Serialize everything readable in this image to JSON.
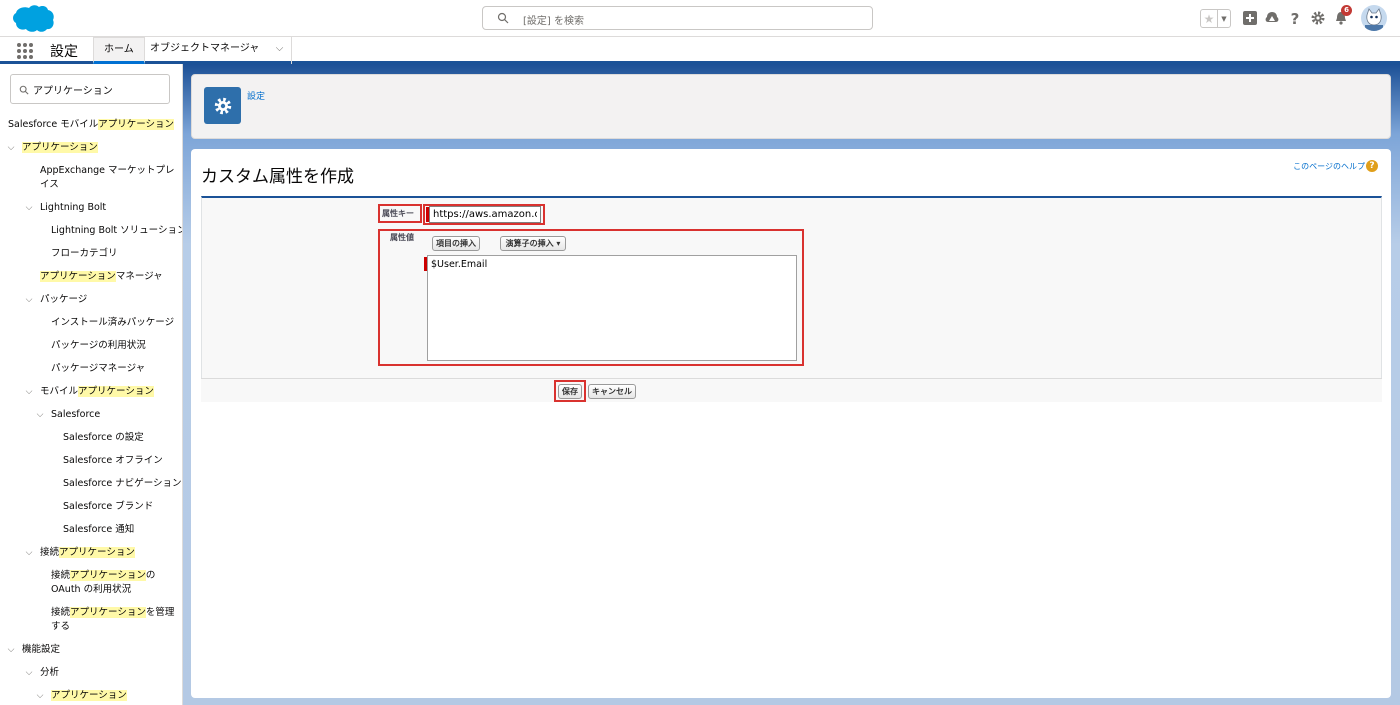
{
  "header": {
    "search_placeholder": "[設定] を検索",
    "notification_count": "6",
    "colors": {
      "brand": "#00a1e0",
      "nav_blue": "#1b5297",
      "badge": "#c23934"
    },
    "icons": [
      "salesforce-logo",
      "search-icon",
      "favorites-star-icon",
      "favorites-dropdown-icon",
      "global-actions-plus-icon",
      "trailhead-icon",
      "help-question-icon",
      "setup-gear-icon",
      "notifications-bell-icon",
      "user-avatar"
    ]
  },
  "context_bar": {
    "app_name": "設定",
    "tabs": [
      {
        "label": "ホーム"
      },
      {
        "label": "オブジェクトマネージャ"
      }
    ]
  },
  "sidebar": {
    "quick_find_value": "アプリケーション",
    "items": [
      {
        "pre": "Salesforce モバイル",
        "hl": "アプリケーション",
        "post": ""
      },
      {
        "pre": "",
        "hl": "アプリケーション",
        "post": ""
      },
      {
        "pre": "AppExchange マーケットプレイス",
        "hl": "",
        "post": ""
      },
      {
        "pre": "Lightning Bolt",
        "hl": "",
        "post": ""
      },
      {
        "pre": "Lightning Bolt ソリューション",
        "hl": "",
        "post": ""
      },
      {
        "pre": "フローカテゴリ",
        "hl": "",
        "post": ""
      },
      {
        "pre": "",
        "hl": "アプリケーション",
        "post": "マネージャ"
      },
      {
        "pre": "パッケージ",
        "hl": "",
        "post": ""
      },
      {
        "pre": "インストール済みパッケージ",
        "hl": "",
        "post": ""
      },
      {
        "pre": "パッケージの利用状況",
        "hl": "",
        "post": ""
      },
      {
        "pre": "パッケージマネージャ",
        "hl": "",
        "post": ""
      },
      {
        "pre": "モバイル",
        "hl": "アプリケーション",
        "post": ""
      },
      {
        "pre": "Salesforce",
        "hl": "",
        "post": ""
      },
      {
        "pre": "Salesforce の設定",
        "hl": "",
        "post": ""
      },
      {
        "pre": "Salesforce オフライン",
        "hl": "",
        "post": ""
      },
      {
        "pre": "Salesforce ナビゲーション",
        "hl": "",
        "post": ""
      },
      {
        "pre": "Salesforce ブランド",
        "hl": "",
        "post": ""
      },
      {
        "pre": "Salesforce 通知",
        "hl": "",
        "post": ""
      },
      {
        "pre": "接続",
        "hl": "アプリケーション",
        "post": ""
      },
      {
        "pre": "接続",
        "hl": "アプリケーション",
        "post": "の"
      },
      {
        "pre": "OAuth の利用状況",
        "hl": "",
        "post": ""
      },
      {
        "pre": "接続",
        "hl": "アプリケーション",
        "post": "を管理"
      },
      {
        "pre": "する",
        "hl": "",
        "post": ""
      },
      {
        "pre": "機能設定",
        "hl": "",
        "post": ""
      },
      {
        "pre": "分析",
        "hl": "",
        "post": ""
      },
      {
        "pre": "",
        "hl": "アプリケーション",
        "post": ""
      }
    ]
  },
  "page_header": {
    "breadcrumb": "設定"
  },
  "content": {
    "title": "カスタム属性を作成",
    "help_link": "このページのヘルプ",
    "form": {
      "key_label": "属性キー",
      "key_value": "https://aws.amazon.com/SAML/Attributes/PrincipalTag:Email",
      "value_label": "属性値",
      "insert_field_button": "項目の挿入",
      "insert_operator_button": "演算子の挿入",
      "value_text": "$User.Email"
    },
    "buttons": {
      "save": "保存",
      "cancel": "キャンセル"
    }
  }
}
